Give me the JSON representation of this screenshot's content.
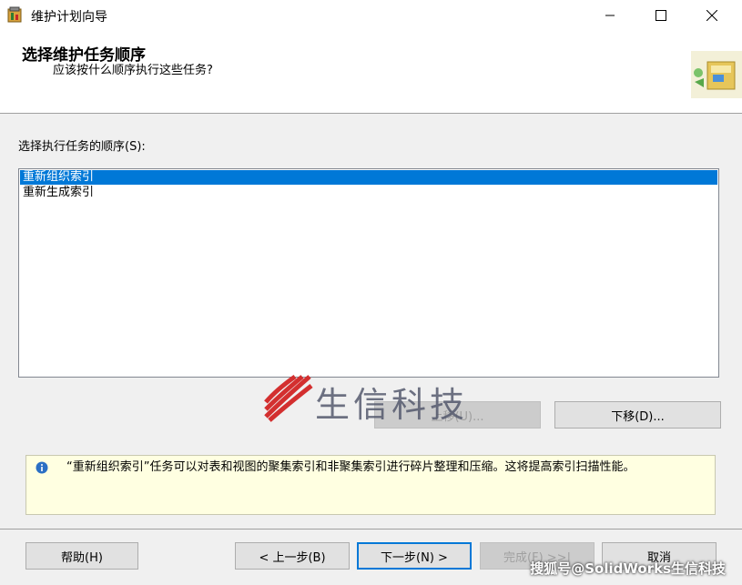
{
  "window": {
    "title": "维护计划向导",
    "controls": {
      "minimize": "minimize-icon",
      "maximize": "maximize-icon",
      "close": "close-icon"
    }
  },
  "header": {
    "title": "选择维护任务顺序",
    "subtitle": "应该按什么顺序执行这些任务?"
  },
  "order": {
    "label": "选择执行任务的顺序(S):",
    "items": [
      {
        "label": "重新组织索引",
        "selected": true
      },
      {
        "label": "重新生成索引",
        "selected": false
      }
    ]
  },
  "buttons": {
    "move_up": "上移(U)...",
    "move_down": "下移(D)...",
    "help": "帮助(H)",
    "back": "< 上一步(B)",
    "next": "下一步(N) >",
    "finish": "完成(F) >>|",
    "cancel": "取消"
  },
  "info": {
    "text": "“重新组织索引”任务可以对表和视图的聚集索引和非聚集索引进行碎片整理和压缩。这将提高索引扫描性能。"
  },
  "watermark": {
    "center_text": "生信科技",
    "corner_text": "搜狐号@SolidWorks生信科技"
  },
  "colors": {
    "selection": "#0078d7",
    "info_background": "#ffffe1",
    "default_button_border": "#0078d7"
  }
}
